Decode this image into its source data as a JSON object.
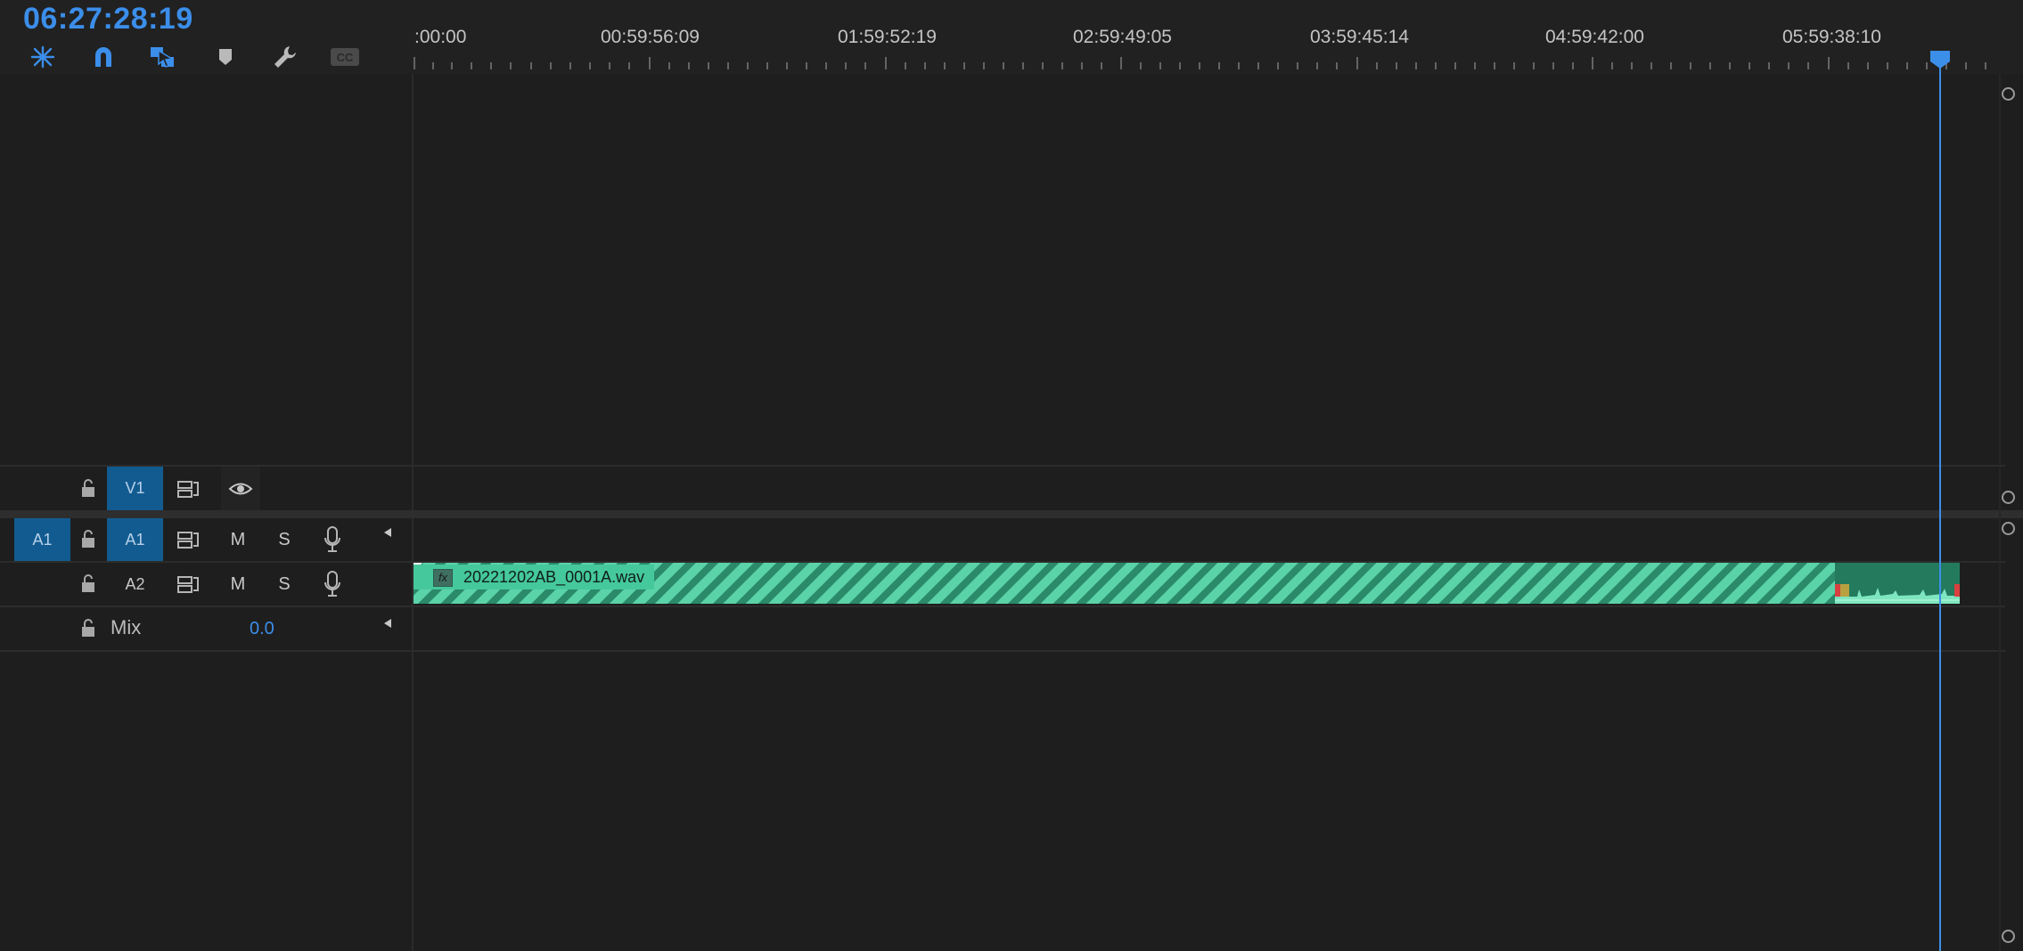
{
  "header": {
    "timecode": "06:27:28:19",
    "tools": [
      {
        "name": "snap-to-sequence-icon"
      },
      {
        "name": "snap-magnet-icon"
      },
      {
        "name": "linked-selection-icon"
      },
      {
        "name": "add-marker-icon"
      },
      {
        "name": "timeline-settings-wrench-icon"
      },
      {
        "name": "captions-cc-icon"
      }
    ]
  },
  "ruler": {
    "labels": [
      ":00:00",
      "00:59:56:09",
      "01:59:52:19",
      "02:59:49:05",
      "03:59:45:14",
      "04:59:42:00",
      "05:59:38:10"
    ]
  },
  "tracks": {
    "v1": {
      "target_label": "V1"
    },
    "a1": {
      "source_label": "A1",
      "target_label": "A1",
      "mute": "M",
      "solo": "S"
    },
    "a2": {
      "target_label": "A2",
      "mute": "M",
      "solo": "S"
    },
    "mix": {
      "label": "Mix",
      "value": "0.0"
    }
  },
  "clip": {
    "name": "20221202AB_0001A.wav",
    "fx_badge": "fx",
    "color": "#45c89c"
  },
  "colors": {
    "accent": "#3b8eea",
    "track_target": "#125b90",
    "clip_stripe_dark": "#2a8a6a"
  }
}
